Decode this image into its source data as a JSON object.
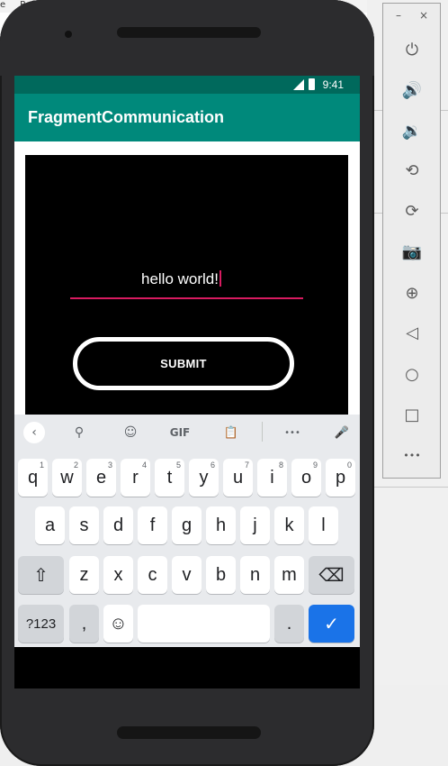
{
  "ide": {
    "menu_fragments": [
      "e",
      "Ref"
    ]
  },
  "device": {
    "status": {
      "time": "9:41"
    },
    "app": {
      "title": "FragmentCommunication"
    },
    "fragment": {
      "input_value": "hello world!",
      "submit_label": "SUBMIT"
    },
    "keyboard": {
      "toolbar": {
        "back_icon": "‹",
        "search_icon": "⚲",
        "sticker_icon": "☺",
        "gif_label": "GIF",
        "clipboard_icon": "📋",
        "more_icon": "•••",
        "mic_icon": "🎤"
      },
      "row1": [
        {
          "k": "q",
          "h": "1"
        },
        {
          "k": "w",
          "h": "2"
        },
        {
          "k": "e",
          "h": "3"
        },
        {
          "k": "r",
          "h": "4"
        },
        {
          "k": "t",
          "h": "5"
        },
        {
          "k": "y",
          "h": "6"
        },
        {
          "k": "u",
          "h": "7"
        },
        {
          "k": "i",
          "h": "8"
        },
        {
          "k": "o",
          "h": "9"
        },
        {
          "k": "p",
          "h": "0"
        }
      ],
      "row2": [
        "a",
        "s",
        "d",
        "f",
        "g",
        "h",
        "j",
        "k",
        "l"
      ],
      "row3": [
        "z",
        "x",
        "c",
        "v",
        "b",
        "n",
        "m"
      ],
      "shift_icon": "⇧",
      "backspace_icon": "⌫",
      "symbols_label": "?123",
      "comma": ",",
      "emoji_icon": "☺",
      "period": ".",
      "enter_icon": "✓"
    }
  },
  "emulator_panel": {
    "minimize_icon": "–",
    "close_icon": "×",
    "buttons": [
      {
        "name": "power-icon",
        "glyph": "⏻"
      },
      {
        "name": "volume-up-icon",
        "glyph": "🔊"
      },
      {
        "name": "volume-down-icon",
        "glyph": "🔉"
      },
      {
        "name": "rotate-left-icon",
        "glyph": "⟲"
      },
      {
        "name": "rotate-right-icon",
        "glyph": "⟳"
      },
      {
        "name": "camera-icon",
        "glyph": "📷"
      },
      {
        "name": "zoom-icon",
        "glyph": "⊕"
      },
      {
        "name": "back-icon",
        "glyph": "◁"
      },
      {
        "name": "home-icon",
        "glyph": "○"
      },
      {
        "name": "overview-icon",
        "glyph": "□"
      },
      {
        "name": "more-icon",
        "glyph": "•••"
      }
    ]
  }
}
